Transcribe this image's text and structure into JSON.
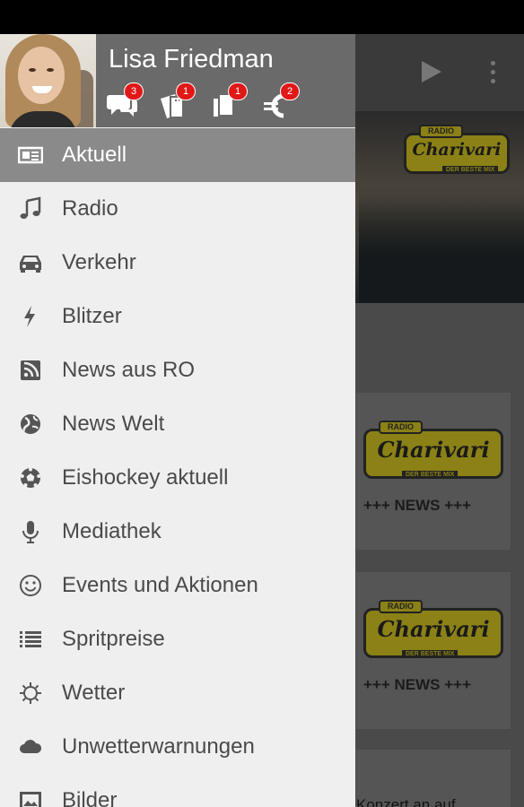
{
  "user": {
    "name": "Lisa Friedman"
  },
  "header_badges": [
    {
      "icon": "chat-icon",
      "count": "3"
    },
    {
      "icon": "tickets-icon",
      "count": "1"
    },
    {
      "icon": "copy-icon",
      "count": "1"
    },
    {
      "icon": "euro-icon",
      "count": "2"
    }
  ],
  "menu": [
    {
      "label": "Aktuell",
      "icon": "newspaper-icon",
      "active": true
    },
    {
      "label": "Radio",
      "icon": "music-note-icon"
    },
    {
      "label": "Verkehr",
      "icon": "car-icon"
    },
    {
      "label": "Blitzer",
      "icon": "lightning-icon"
    },
    {
      "label": "News aus RO",
      "icon": "rss-icon"
    },
    {
      "label": "News Welt",
      "icon": "globe-icon"
    },
    {
      "label": "Eishockey aktuell",
      "icon": "ball-icon"
    },
    {
      "label": "Mediathek",
      "icon": "microphone-icon"
    },
    {
      "label": "Events und Aktionen",
      "icon": "smiley-icon"
    },
    {
      "label": "Spritpreise",
      "icon": "list-icon"
    },
    {
      "label": "Wetter",
      "icon": "sun-icon"
    },
    {
      "label": "Unwetterwarnungen",
      "icon": "cloud-icon"
    },
    {
      "label": "Bilder",
      "icon": "image-icon"
    }
  ],
  "background": {
    "logo_brand": "Charivari",
    "logo_radio": "RADIO",
    "logo_claim": "DER BESTE MIX",
    "card_news": "+++ NEWS +++",
    "partial_teaser": "Konzert an auf"
  },
  "colors": {
    "drawer_bg": "#efefef",
    "header_bg": "#6a6a6a",
    "active_item_bg": "#8a8a8a",
    "badge_red": "#e01818",
    "logo_yellow": "#8b8116"
  }
}
